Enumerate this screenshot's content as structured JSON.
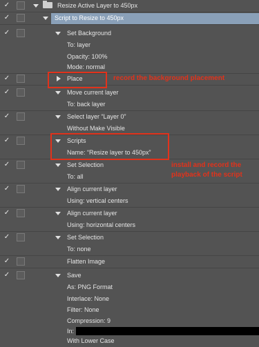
{
  "set": {
    "label": "Resize Active Layer to 450px"
  },
  "action": {
    "label": "Script to Resize to 450px"
  },
  "steps": [
    {
      "label": "Set Background"
    },
    {
      "label": "To: layer"
    },
    {
      "label": "Opacity: 100%"
    },
    {
      "label": "Mode: normal"
    },
    {
      "label": "Place"
    },
    {
      "label": "Move current layer"
    },
    {
      "label": "To: back layer"
    },
    {
      "label": "Select layer “Layer 0”"
    },
    {
      "label": "Without Make Visible"
    },
    {
      "label": "Scripts"
    },
    {
      "label": "Name:  “Resize layer to 450px”"
    },
    {
      "label": "Set Selection"
    },
    {
      "label": "To: all"
    },
    {
      "label": "Align current layer"
    },
    {
      "label": "Using: vertical centers"
    },
    {
      "label": "Align current layer"
    },
    {
      "label": "Using: horizontal centers"
    },
    {
      "label": "Set Selection"
    },
    {
      "label": "To: none"
    },
    {
      "label": "Flatten Image"
    },
    {
      "label": "Save"
    },
    {
      "label": "As: PNG Format"
    },
    {
      "label": "Interlace: None"
    },
    {
      "label": "Filter: None"
    },
    {
      "label": "Compression: 9"
    },
    {
      "label": "In:"
    },
    {
      "label": "With Lower Case"
    }
  ],
  "annotations": {
    "place_note": "record the background placement",
    "script_note_line1": "install and record the",
    "script_note_line2": "playback of the script"
  },
  "colors": {
    "annotation": "#e2321b",
    "selection": "#8aa0b8",
    "panel": "#535353"
  }
}
